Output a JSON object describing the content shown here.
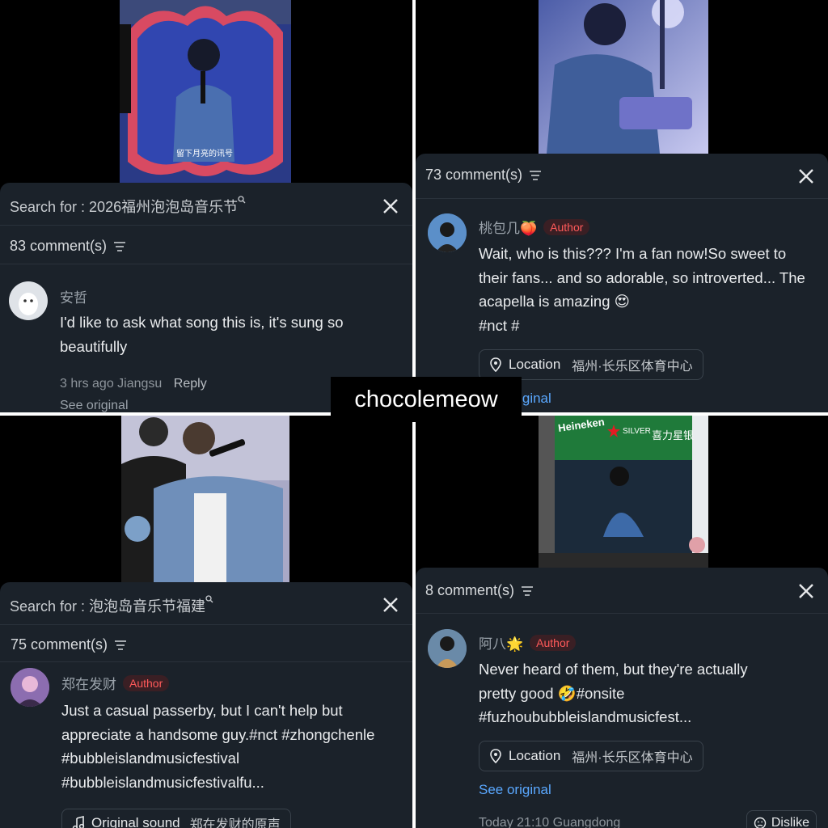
{
  "watermark": "chocolemeow",
  "screens": {
    "top_left": {
      "overlay_text": "留下月亮的讯号",
      "search_prefix": "Search for : ",
      "search_query": "2026福州泡泡岛音乐节",
      "comment_count": "83 comment(s)",
      "comment": {
        "user": "安哲",
        "text": "I'd like to ask what song this is, it's sung so beautifully",
        "time": "3 hrs ago",
        "region": "Jiangsu",
        "reply": "Reply",
        "see_original": "See original"
      }
    },
    "top_right": {
      "comment_count": "73 comment(s)",
      "comment": {
        "user": "桃包几🍑",
        "badge": "Author",
        "text": "Wait, who is this??? I'm a fan now!So sweet to their fans... and so adorable, so introverted... The acapella is amazing 😍",
        "tags": "#nct #",
        "location_label": "Location",
        "location_value": "福州·长乐区体育中心",
        "see_original": "See original"
      }
    },
    "bottom_left": {
      "search_prefix": "Search for : ",
      "search_query": "泡泡岛音乐节福建",
      "comment_count": "75 comment(s)",
      "comment": {
        "user": "郑在发财",
        "badge": "Author",
        "text": "Just a casual passerby, but I can't help but appreciate a handsome guy.#nct #zhongchenle #bubbleislandmusicfestival #bubbleislandmusicfestivalfu...",
        "sound_label": "Original sound",
        "sound_value": "郑在发财的原声"
      }
    },
    "bottom_right": {
      "banner_brand": "Heineken",
      "banner_silver": "SILVER",
      "banner_cn": "喜力星银",
      "comment_count": "8 comment(s)",
      "comment": {
        "user": "阿八🌟",
        "badge": "Author",
        "text": "Never heard of them, but they're actually pretty good 🤣#onsite #fuzhoububbleislandmusicfest...",
        "location_label": "Location",
        "location_value": "福州·长乐区体育中心",
        "see_original": "See original",
        "time": "Today 21:10",
        "region": "Guangdong",
        "dislike": "Dislike"
      }
    }
  },
  "colors": {
    "panel_bg": "#1b222a",
    "badge_red": "#ff5a5a",
    "link_blue": "#5aa8ff"
  }
}
